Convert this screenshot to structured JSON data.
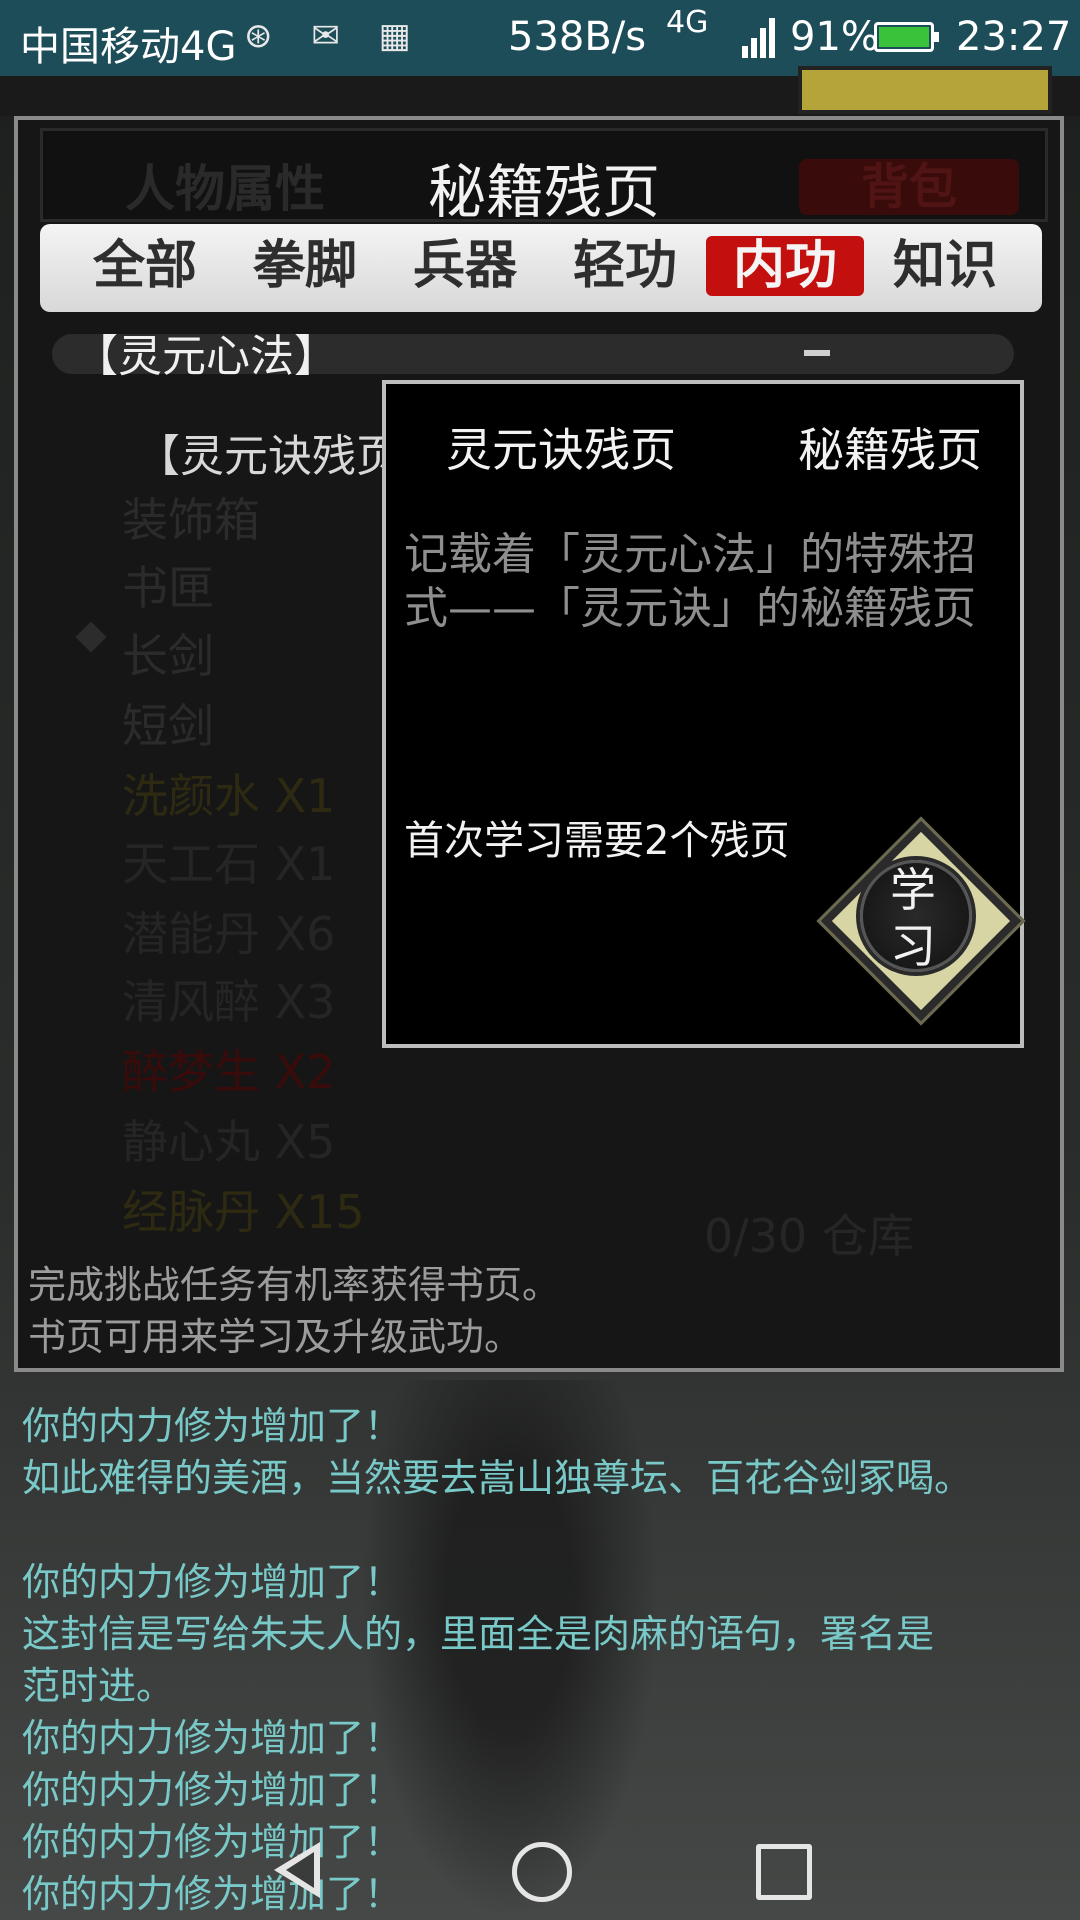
{
  "status_bar": {
    "carrier": "中国移动4G",
    "net_speed": "538B/s",
    "net_type": "4G",
    "net_type2": "4G 2G",
    "battery_pct": "91%",
    "time": "23:27"
  },
  "panel": {
    "header_left": "人物属性",
    "title": "秘籍残页",
    "header_right": "背包",
    "tabs": [
      {
        "label": "全部"
      },
      {
        "label": "拳脚"
      },
      {
        "label": "兵器"
      },
      {
        "label": "轻功"
      },
      {
        "label": "内功",
        "active": true
      },
      {
        "label": "知识"
      }
    ],
    "list_header": "【灵元心法】",
    "selected_item": "【灵元诀残页】",
    "bg_items": [
      {
        "label": "装饰箱"
      },
      {
        "label": "书匣"
      },
      {
        "label": "长剑"
      },
      {
        "label": "短剑"
      },
      {
        "label": "洗颜水 X1"
      },
      {
        "label": "天工石 X1"
      },
      {
        "label": "潜能丹 X6"
      },
      {
        "label": "清风醉 X3"
      },
      {
        "label": "醉梦生 X2"
      },
      {
        "label": "静心丸 X5"
      },
      {
        "label": "经脉丹 X15"
      }
    ],
    "hint_line1": "完成挑战任务有机率获得书页。",
    "hint_line2": "书页可用来学习及升级武功。",
    "capacity": "0/30 仓库"
  },
  "popup": {
    "item_name": "灵元诀残页",
    "item_type": "秘籍残页",
    "description": "记载着「灵元心法」的特殊招式——「灵元诀」的秘籍残页",
    "requirement": "首次学习需要2个残页",
    "learn_label_1": "学",
    "learn_label_2": "习"
  },
  "log": {
    "lines": [
      "你的内力修为增加了！",
      "如此难得的美酒，当然要去嵩山独尊坛、百花谷剑冢喝。",
      "",
      "你的内力修为增加了！",
      "这封信是写给朱夫人的，里面全是肉麻的语句，署名是",
      "范时进。",
      "你的内力修为增加了！",
      "你的内力修为增加了！",
      "你的内力修为增加了！",
      "你的内力修为增加了！"
    ]
  },
  "colors": {
    "active_tab": "#c40f0f",
    "log_text": "#78c9c8",
    "status_bar": "#1d4d58"
  }
}
